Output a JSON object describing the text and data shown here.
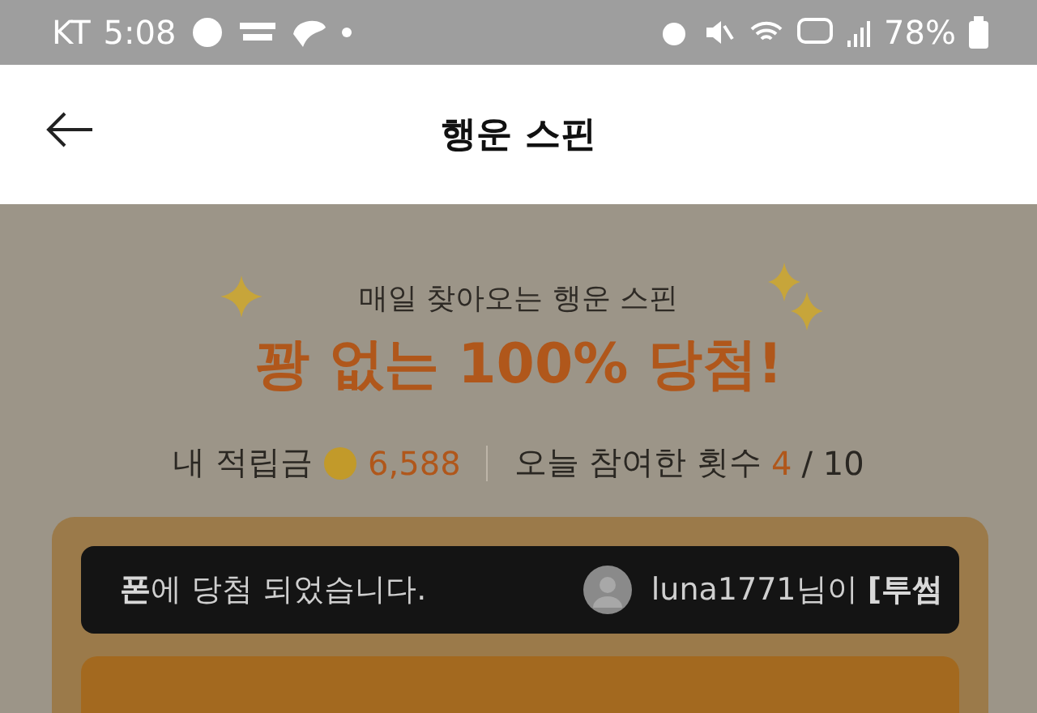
{
  "status_bar": {
    "carrier": "KT",
    "time": "5:08",
    "battery": "78%"
  },
  "header": {
    "title": "행운 스핀"
  },
  "promo": {
    "subtitle": "매일 찾아오는 행운 스핀",
    "headline": "꽝 없는 100% 당첨!"
  },
  "stats": {
    "points_label": "내 적립금",
    "points": "6,588",
    "count_label": "오늘 참여한 횟수",
    "count": "4",
    "count_total": "/ 10"
  },
  "ticker": {
    "message": "**폰**에 당첨 되었습니다.",
    "winner": "luna1771님이 **[투썸**"
  }
}
